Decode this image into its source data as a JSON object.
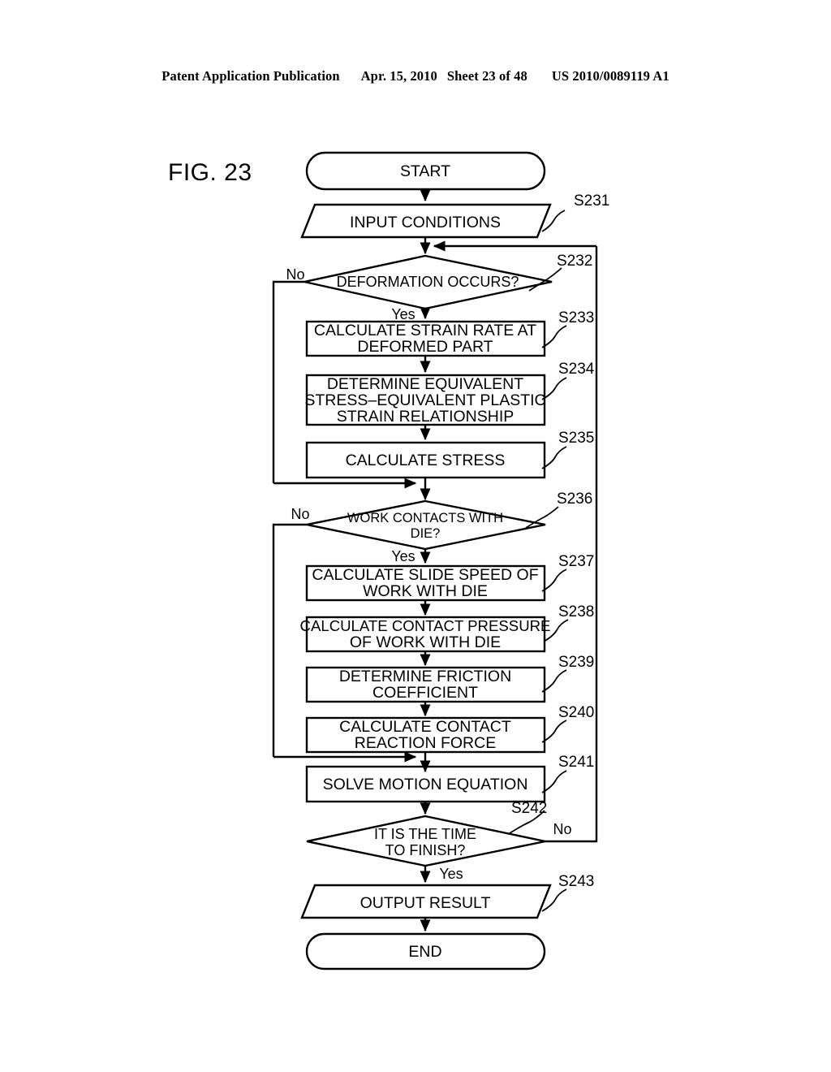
{
  "header": {
    "publication": "Patent Application Publication",
    "date": "Apr. 15, 2010",
    "sheet": "Sheet 23 of 48",
    "number": "US 2010/0089119 A1"
  },
  "figure": {
    "label": "FIG. 23",
    "title": ""
  },
  "flowchart": {
    "type": "flowchart",
    "nodes": [
      {
        "id": "start",
        "shape": "terminator",
        "text": "START",
        "step": ""
      },
      {
        "id": "s231",
        "shape": "parallelogram",
        "text": "INPUT CONDITIONS",
        "step": "S231"
      },
      {
        "id": "s232",
        "shape": "decision",
        "text": "DEFORMATION OCCURS?",
        "step": "S232"
      },
      {
        "id": "s233",
        "shape": "process",
        "text_l1": "CALCULATE STRAIN RATE AT",
        "text_l2": "DEFORMED PART",
        "step": "S233"
      },
      {
        "id": "s234",
        "shape": "process",
        "text_l1": "DETERMINE EQUIVALENT",
        "text_l2": "STRESS–EQUIVALENT PLASTIC",
        "text_l3": "STRAIN RELATIONSHIP",
        "step": "S234"
      },
      {
        "id": "s235",
        "shape": "process",
        "text_l1": "CALCULATE STRESS",
        "step": "S235"
      },
      {
        "id": "s236",
        "shape": "decision",
        "text_l1": "WORK CONTACTS WITH",
        "text_l2": "DIE?",
        "step": "S236"
      },
      {
        "id": "s237",
        "shape": "process",
        "text_l1": "CALCULATE SLIDE SPEED OF",
        "text_l2": "WORK WITH DIE",
        "step": "S237"
      },
      {
        "id": "s238",
        "shape": "process",
        "text_l1": "CALCULATE CONTACT PRESSURE",
        "text_l2": "OF WORK WITH DIE",
        "step": "S238"
      },
      {
        "id": "s239",
        "shape": "process",
        "text_l1": "DETERMINE FRICTION",
        "text_l2": "COEFFICIENT",
        "step": "S239"
      },
      {
        "id": "s240",
        "shape": "process",
        "text_l1": "CALCULATE CONTACT",
        "text_l2": "REACTION FORCE",
        "step": "S240"
      },
      {
        "id": "s241",
        "shape": "process",
        "text_l1": "SOLVE MOTION EQUATION",
        "step": "S241"
      },
      {
        "id": "s242",
        "shape": "decision",
        "text_l1": "IT IS THE TIME",
        "text_l2": "TO FINISH?",
        "step": "S242"
      },
      {
        "id": "s243",
        "shape": "parallelogram",
        "text": "OUTPUT RESULT",
        "step": "S243"
      },
      {
        "id": "end",
        "shape": "terminator",
        "text": "END",
        "step": ""
      }
    ],
    "branch_labels": {
      "s232_no": "No",
      "s232_yes": "Yes",
      "s236_no": "No",
      "s236_yes": "Yes",
      "s242_no": "No",
      "s242_yes": "Yes"
    }
  }
}
